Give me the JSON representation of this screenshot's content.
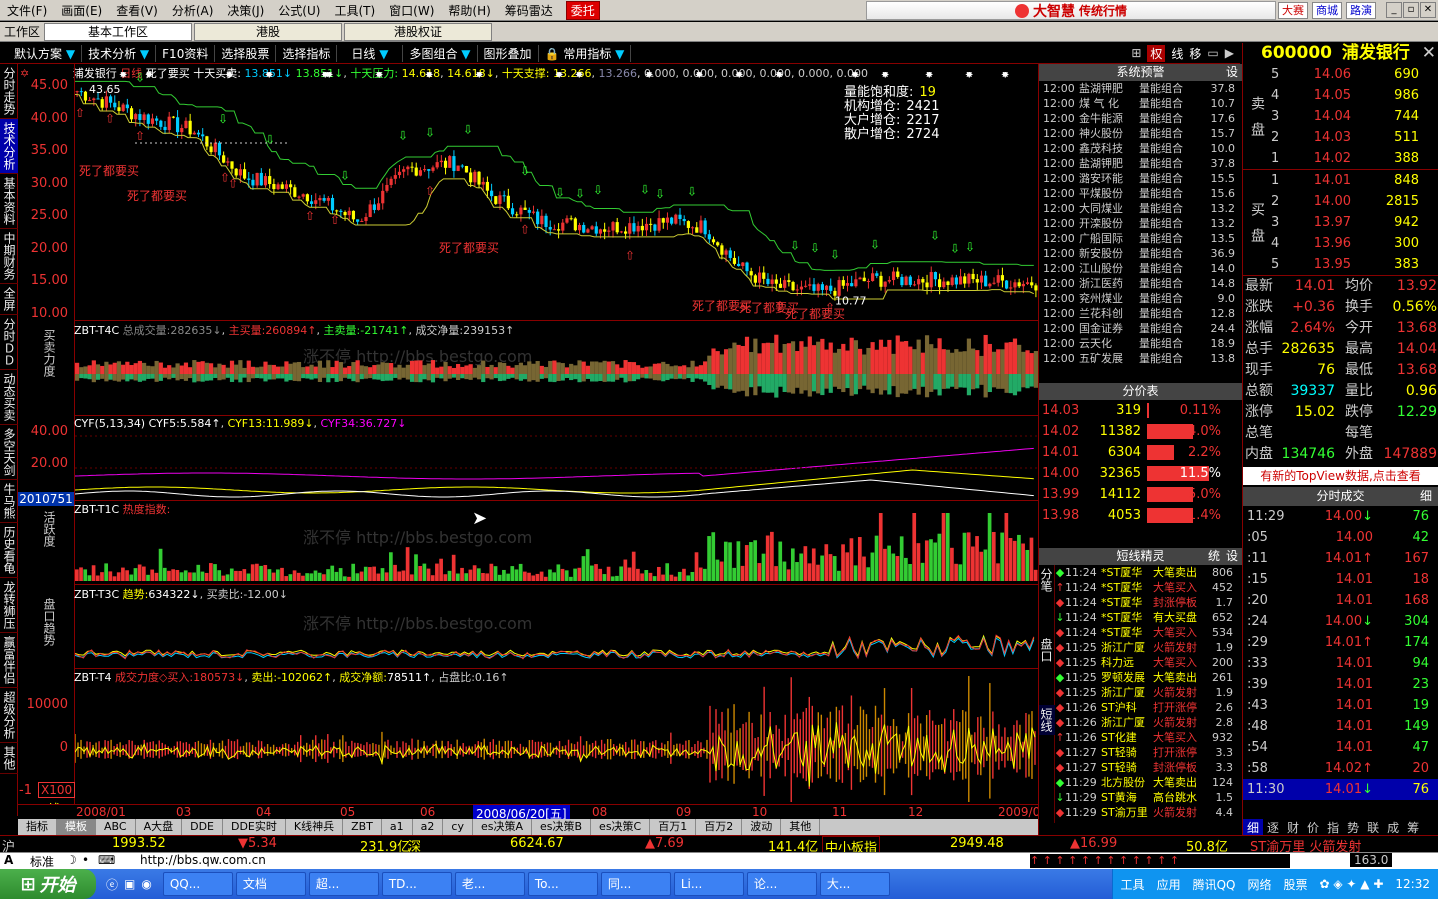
{
  "menu": {
    "items": [
      "文件(F)",
      "画面(E)",
      "查看(V)",
      "分析(A)",
      "决策(J)",
      "公式(U)",
      "工具(T)",
      "窗口(W)",
      "帮助(H)",
      "筹码雷达"
    ],
    "delegate": "委托",
    "brand": "大智慧",
    "brand_sub": "传统行情",
    "btn_dasai": "大赛",
    "btn_shangcheng": "商城",
    "btn_luyan": "路演"
  },
  "tabbar": {
    "label": "工作区",
    "tabs": [
      "基本工作区",
      "港股",
      "港股权证"
    ]
  },
  "toolbar": {
    "items": [
      "默认方案",
      "技术分析",
      "F10资料",
      "选择股票",
      "选择指标",
      "日线",
      "多图组合",
      "图形叠加",
      "常用指标"
    ],
    "right_icons": [
      "权",
      "线",
      "移"
    ]
  },
  "left_tabs": [
    {
      "label": "分时走势",
      "selected": false
    },
    {
      "label": "技术分析",
      "selected": true
    },
    {
      "label": "基本资料",
      "selected": false
    },
    {
      "label": "中期财务",
      "selected": false
    },
    {
      "label": "全屏",
      "selected": false
    },
    {
      "label": "分时ＤＤ",
      "selected": false
    },
    {
      "label": "动态买卖",
      "selected": false
    },
    {
      "label": "多空天剑",
      "selected": false
    },
    {
      "label": "牛马熊",
      "selected": false
    },
    {
      "label": "历史看龟",
      "selected": false
    },
    {
      "label": "龙转狮压",
      "selected": false
    },
    {
      "label": "赢富伴侣",
      "selected": false
    },
    {
      "label": "超级分析",
      "selected": false
    },
    {
      "label": "其他",
      "selected": false
    }
  ],
  "main_chart": {
    "header": {
      "stock": "浦发银行",
      "period": "日线",
      "signal": "死了要买",
      "s1_label": "十天买卖:",
      "s1_val": "13.851↓",
      "s1_val2": "13.851↓",
      "s2_label": "十天压力:",
      "s2_val": "14.618",
      "s2_val2": "14.618↓",
      "s3_label": "十天支撑:",
      "s3_val": "13.266",
      "s3_val2": "13.266",
      "tail": "0.000, 0.000, 0.000, 0.000, 0.000, 0.000"
    },
    "yaxis": [
      "45.00",
      "40.00",
      "35.00",
      "30.00",
      "25.00",
      "20.00",
      "15.00",
      "10.00"
    ],
    "high_label": "43.65",
    "low_label": "10.77",
    "signal_texts": [
      "死了都要买",
      "死了都要买",
      "死了都要买",
      "死了都要买",
      "死了都要买",
      "死了都要买"
    ],
    "legend": [
      {
        "label": "量能饱和度:",
        "val": "19"
      },
      {
        "label": "机构增仓:",
        "val": "2421"
      },
      {
        "label": "大户增仓:",
        "val": "2217"
      },
      {
        "label": "散户增仓:",
        "val": "2724"
      }
    ]
  },
  "panel_t4c": {
    "name": "ZBT-T4C",
    "k1": "总成交量:",
    "v1": "282635↓",
    "k2": "主买量:",
    "v2": "260894↑",
    "k3": "主卖量:",
    "v3": "-21741↑",
    "k4": "成交净量:",
    "v4": "239153↑",
    "vlabel": "买卖力度",
    "watermark": "涨不停 http://bbs.bestgo.com"
  },
  "panel_cyf": {
    "name": "CYF(5,13,34)",
    "k1": "CYF5:",
    "v1": "5.584↑",
    "k2": "CYF13:",
    "v2": "11.989↓",
    "k3": "CYF34:",
    "v3": "36.727↓",
    "yaxis": [
      "40.00",
      "20.00"
    ],
    "date_badge": "2010751"
  },
  "panel_t1c": {
    "name": "ZBT-T1C",
    "k1": "热度指数:",
    "vlabel": "活跃度",
    "watermark": "涨不停 http://bbs.bestgo.com"
  },
  "panel_t3c": {
    "name": "ZBT-T3C",
    "k1": "趋势:",
    "v1": "634322↓",
    "k2": "买卖比:",
    "v2": "-12.00↓",
    "vlabel": "盘口趋势",
    "watermark": "涨不停 http://bbs.bestgo.com"
  },
  "panel_t4": {
    "name": "ZBT-T4",
    "k1": "成交力度◇买入:",
    "v1": "180573↓",
    "k2": "卖出:",
    "v2": "-102062↑",
    "k3": "成交净额:",
    "v3": "78511↑",
    "k4": "占盘比:",
    "v4": "0.16↑",
    "yaxis": [
      "10000",
      "0",
      "-1"
    ],
    "unit": "X100"
  },
  "xaxis": {
    "labels": [
      "2008/01",
      "03",
      "04",
      "05",
      "06",
      "2008/06/20[五]",
      "08",
      "09",
      "10",
      "11",
      "12",
      "2009/01"
    ]
  },
  "indicator_tabs": [
    "指标",
    "模板",
    "ABC",
    "A大盘",
    "DDE",
    "DDE实时",
    "K线神兵",
    "ZBT",
    "a1",
    "a2",
    "cy",
    "es决策A",
    "es决策B",
    "es决策C",
    "百万1",
    "百万2",
    "波动",
    "其他"
  ],
  "alerts": {
    "title": "系统预警",
    "btn": "设",
    "rows": [
      {
        "t": "12:00",
        "n": "盐湖钾肥",
        "g": "量能组合",
        "p": "37.8"
      },
      {
        "t": "12:00",
        "n": "煤 气 化",
        "g": "量能组合",
        "p": "10.7"
      },
      {
        "t": "12:00",
        "n": "金牛能源",
        "g": "量能组合",
        "p": "17.6"
      },
      {
        "t": "12:00",
        "n": "神火股份",
        "g": "量能组合",
        "p": "15.7"
      },
      {
        "t": "12:00",
        "n": "鑫茂科技",
        "g": "量能组合",
        "p": "10.0"
      },
      {
        "t": "12:00",
        "n": "盐湖钾肥",
        "g": "量能组合",
        "p": "37.8"
      },
      {
        "t": "12:00",
        "n": "潞安环能",
        "g": "量能组合",
        "p": "15.5"
      },
      {
        "t": "12:00",
        "n": "平煤股份",
        "g": "量能组合",
        "p": "15.6"
      },
      {
        "t": "12:00",
        "n": "大同煤业",
        "g": "量能组合",
        "p": "13.2"
      },
      {
        "t": "12:00",
        "n": "开滦股份",
        "g": "量能组合",
        "p": "13.2"
      },
      {
        "t": "12:00",
        "n": "广船国际",
        "g": "量能组合",
        "p": "13.5"
      },
      {
        "t": "12:00",
        "n": "新安股份",
        "g": "量能组合",
        "p": "36.9"
      },
      {
        "t": "12:00",
        "n": "江山股份",
        "g": "量能组合",
        "p": "14.0"
      },
      {
        "t": "12:00",
        "n": "浙江医药",
        "g": "量能组合",
        "p": "14.8"
      },
      {
        "t": "12:00",
        "n": "兖州煤业",
        "g": "量能组合",
        "p": "9.0"
      },
      {
        "t": "12:00",
        "n": "兰花科创",
        "g": "量能组合",
        "p": "12.8"
      },
      {
        "t": "12:00",
        "n": "国金证券",
        "g": "量能组合",
        "p": "24.4"
      },
      {
        "t": "12:00",
        "n": "云天化",
        "g": "量能组合",
        "p": "18.9"
      },
      {
        "t": "12:00",
        "n": "五矿发展",
        "g": "量能组合",
        "p": "13.8"
      }
    ]
  },
  "price_table": {
    "title": "分价表",
    "rows": [
      {
        "p": "14.03",
        "v": "319",
        "pct": "0.11%",
        "fill": 0.02
      },
      {
        "p": "14.02",
        "v": "11382",
        "pct": "4.0%",
        "fill": 0.6
      },
      {
        "p": "14.01",
        "v": "6304",
        "pct": "2.2%",
        "fill": 0.35
      },
      {
        "p": "14.00",
        "v": "32365",
        "pct": "11.5%",
        "fill": 0.82
      },
      {
        "p": "13.99",
        "v": "14112",
        "pct": "5.0%",
        "fill": 0.6
      },
      {
        "p": "13.98",
        "v": "4053",
        "pct": "1.4%",
        "fill": 0.6
      }
    ]
  },
  "sprite": {
    "title": "短线精灵",
    "btns": [
      "统",
      "设"
    ],
    "side_labels": [
      "分笔",
      "盘口",
      "短线"
    ],
    "rows": [
      {
        "i": "◆",
        "ic": "#3f3",
        "t": "11:24",
        "n": "*ST厦华",
        "nc": "#ff0",
        "a": "大笔卖出",
        "ac": "#ff0",
        "p": "806"
      },
      {
        "i": "↑",
        "ic": "#e33",
        "t": "11:24",
        "n": "*ST厦华",
        "nc": "#ff0",
        "a": "大笔买入",
        "ac": "#e33",
        "p": "452"
      },
      {
        "i": "◆",
        "ic": "#e33",
        "t": "11:24",
        "n": "*ST厦华",
        "nc": "#ff0",
        "a": "封涨停板",
        "ac": "#e33",
        "p": "1.7"
      },
      {
        "i": "↓",
        "ic": "#3f3",
        "t": "11:24",
        "n": "*ST厦华",
        "nc": "#ff0",
        "a": "有大买盘",
        "ac": "#ff0",
        "p": "652"
      },
      {
        "i": "◆",
        "ic": "#e33",
        "t": "11:24",
        "n": "*ST厦华",
        "nc": "#ff0",
        "a": "大笔买入",
        "ac": "#e33",
        "p": "534"
      },
      {
        "i": "◆",
        "ic": "#e33",
        "t": "11:25",
        "n": "浙江广厦",
        "nc": "#ff0",
        "a": "火箭发射",
        "ac": "#e33",
        "p": "1.9"
      },
      {
        "i": "◆",
        "ic": "#e33",
        "t": "11:25",
        "n": "科力远",
        "nc": "#ff0",
        "a": "大笔买入",
        "ac": "#e33",
        "p": "200"
      },
      {
        "i": "◆",
        "ic": "#3f3",
        "t": "11:25",
        "n": "罗顿发展",
        "nc": "#ff0",
        "a": "大笔卖出",
        "ac": "#ff0",
        "p": "261"
      },
      {
        "i": "◆",
        "ic": "#e33",
        "t": "11:25",
        "n": "浙江广厦",
        "nc": "#ff0",
        "a": "火箭发射",
        "ac": "#e33",
        "p": "1.9"
      },
      {
        "i": "◆",
        "ic": "#e33",
        "t": "11:26",
        "n": "ST沪科",
        "nc": "#ff0",
        "a": "打开涨停",
        "ac": "#e33",
        "p": "2.6"
      },
      {
        "i": "◆",
        "ic": "#e33",
        "t": "11:26",
        "n": "浙江广厦",
        "nc": "#ff0",
        "a": "火箭发射",
        "ac": "#e33",
        "p": "2.8"
      },
      {
        "i": "↑",
        "ic": "#e33",
        "t": "11:26",
        "n": "ST化建",
        "nc": "#ff0",
        "a": "大笔买入",
        "ac": "#e33",
        "p": "932"
      },
      {
        "i": "◆",
        "ic": "#e33",
        "t": "11:27",
        "n": "ST轻骑",
        "nc": "#ff0",
        "a": "打开涨停",
        "ac": "#e33",
        "p": "3.3"
      },
      {
        "i": "◆",
        "ic": "#e33",
        "t": "11:27",
        "n": "ST轻骑",
        "nc": "#ff0",
        "a": "封涨停板",
        "ac": "#e33",
        "p": "3.3"
      },
      {
        "i": "◆",
        "ic": "#3f3",
        "t": "11:29",
        "n": "北方股份",
        "nc": "#ff0",
        "a": "大笔卖出",
        "ac": "#ff0",
        "p": "124"
      },
      {
        "i": "↓",
        "ic": "#3f3",
        "t": "11:29",
        "n": "ST黄海",
        "nc": "#ff0",
        "a": "高台跳水",
        "ac": "#ff0",
        "p": "1.5"
      },
      {
        "i": "◆",
        "ic": "#e33",
        "t": "11:29",
        "n": "ST渝万里",
        "nc": "#ff0",
        "a": "火箭发射",
        "ac": "#e33",
        "p": "4.4"
      }
    ]
  },
  "quote": {
    "code": "600000",
    "name": "浦发银行",
    "sell_label": "卖盘",
    "buy_label": "买盘",
    "asks": [
      {
        "lv": "5",
        "p": "14.06",
        "v": "690"
      },
      {
        "lv": "4",
        "p": "14.05",
        "v": "986"
      },
      {
        "lv": "3",
        "p": "14.04",
        "v": "744"
      },
      {
        "lv": "2",
        "p": "14.03",
        "v": "511"
      },
      {
        "lv": "1",
        "p": "14.02",
        "v": "388"
      }
    ],
    "bids": [
      {
        "lv": "1",
        "p": "14.01",
        "v": "848"
      },
      {
        "lv": "2",
        "p": "14.00",
        "v": "2815"
      },
      {
        "lv": "3",
        "p": "13.97",
        "v": "942"
      },
      {
        "lv": "4",
        "p": "13.96",
        "v": "300"
      },
      {
        "lv": "5",
        "p": "13.95",
        "v": "383"
      }
    ],
    "stats": [
      {
        "k": "最新",
        "v": "14.01",
        "vc": "#e33",
        "k2": "均价",
        "v2": "13.92",
        "v2c": "#e33"
      },
      {
        "k": "涨跌",
        "v": "+0.36",
        "vc": "#e33",
        "k2": "换手",
        "v2": "0.56%",
        "v2c": "#ff0"
      },
      {
        "k": "涨幅",
        "v": "2.64%",
        "vc": "#e33",
        "k2": "今开",
        "v2": "13.68",
        "v2c": "#e33"
      },
      {
        "k": "总手",
        "v": "282635",
        "vc": "#ff0",
        "k2": "最高",
        "v2": "14.04",
        "v2c": "#e33"
      },
      {
        "k": "现手",
        "v": "76",
        "vc": "#ff0",
        "k2": "最低",
        "v2": "13.68",
        "v2c": "#e33"
      },
      {
        "k": "总额",
        "v": "39337",
        "vc": "#0ff",
        "k2": "量比",
        "v2": "0.96",
        "v2c": "#ff0"
      },
      {
        "k": "涨停",
        "v": "15.02",
        "vc": "#ff0",
        "k2": "跌停",
        "v2": "12.29",
        "v2c": "#3f3"
      },
      {
        "k": "总笔",
        "v": "",
        "vc": "#ff0",
        "k2": "每笔",
        "v2": "",
        "v2c": "#ff0"
      },
      {
        "k": "内盘",
        "v": "134746",
        "vc": "#3f3",
        "k2": "外盘",
        "v2": "147889",
        "v2c": "#e33"
      }
    ],
    "topview_notice": "有新的TopView数据,点击查看",
    "trade_title": "分时成交",
    "trade_btn": "细",
    "trades": [
      {
        "t": "11:29",
        "p": "14.00",
        "a": "↓",
        "ac": "#3f3",
        "v": "76",
        "vc": "#3f3"
      },
      {
        "t": ":05",
        "p": "14.00",
        "a": "",
        "ac": "#3f3",
        "v": "42",
        "vc": "#3f3"
      },
      {
        "t": ":11",
        "p": "14.01",
        "a": "↑",
        "ac": "#e33",
        "v": "167",
        "vc": "#e33"
      },
      {
        "t": ":15",
        "p": "14.01",
        "a": "",
        "ac": "#e33",
        "v": "18",
        "vc": "#e33"
      },
      {
        "t": ":20",
        "p": "14.01",
        "a": "",
        "ac": "#e33",
        "v": "168",
        "vc": "#e33"
      },
      {
        "t": ":24",
        "p": "14.00",
        "a": "↓",
        "ac": "#3f3",
        "v": "304",
        "vc": "#3f3"
      },
      {
        "t": ":29",
        "p": "14.01",
        "a": "↑",
        "ac": "#e33",
        "v": "174",
        "vc": "#3f3"
      },
      {
        "t": ":33",
        "p": "14.01",
        "a": "",
        "ac": "#e33",
        "v": "94",
        "vc": "#3f3"
      },
      {
        "t": ":39",
        "p": "14.01",
        "a": "",
        "ac": "#e33",
        "v": "23",
        "vc": "#3f3"
      },
      {
        "t": ":43",
        "p": "14.01",
        "a": "",
        "ac": "#e33",
        "v": "19",
        "vc": "#3f3"
      },
      {
        "t": ":48",
        "p": "14.01",
        "a": "",
        "ac": "#e33",
        "v": "149",
        "vc": "#3f3"
      },
      {
        "t": ":54",
        "p": "14.01",
        "a": "",
        "ac": "#e33",
        "v": "47",
        "vc": "#3f3"
      },
      {
        "t": ":58",
        "p": "14.02",
        "a": "↑",
        "ac": "#e33",
        "v": "20",
        "vc": "#e33"
      },
      {
        "t": "11:30",
        "p": "14.01",
        "a": "↓",
        "ac": "#3f3",
        "v": "76",
        "vc": "#ff0"
      }
    ],
    "bottom_tabs": [
      "细",
      "逐",
      "财",
      "价",
      "指",
      "势",
      "联",
      "成",
      "筹"
    ]
  },
  "ticker": {
    "v1": "1993.52",
    "v2": "▼5.34",
    "v3": "231.9亿",
    "v4": "深",
    "v5": "6624.67",
    "v6": "▲7.69",
    "v7": "141.4亿",
    "v8": "中小板指",
    "v9": "2949.48",
    "v10": "▲16.99",
    "v11": "50.8亿",
    "v12": "ST渝万里 火箭发射",
    "v13": "163.0",
    "v14": "12:32"
  },
  "addr": {
    "mode": "A",
    "label": "标准",
    "url": "http://bbs.qw.com.cn"
  },
  "taskbar": {
    "start": "开始",
    "buttons": [
      "QQ...",
      "文档",
      "超...",
      "TD...",
      "老...",
      "To...",
      "同...",
      "Li...",
      "论...",
      "大..."
    ],
    "tray": [
      "工具",
      "应用",
      "腾讯QQ",
      "网络",
      "股票"
    ],
    "clock": "12:32"
  }
}
